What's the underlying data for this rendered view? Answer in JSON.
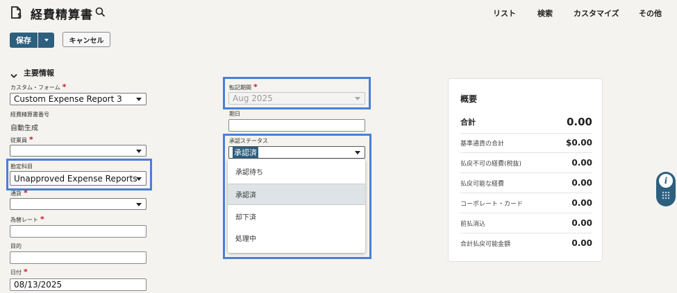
{
  "header": {
    "title": "経費精算書",
    "nav": [
      "リスト",
      "検索",
      "カスタマイズ",
      "その他"
    ]
  },
  "toolbar": {
    "save_label": "保存",
    "cancel_label": "キャンセル"
  },
  "section": {
    "title": "主要情報"
  },
  "fields": {
    "custom_form": {
      "label": "カスタム・フォーム",
      "value": "Custom Expense Report 3"
    },
    "report_number": {
      "label": "経費精算書番号",
      "value": "自動生成"
    },
    "employee": {
      "label": "従業員",
      "value": ""
    },
    "account": {
      "label": "勘定科目",
      "value": "Unapproved Expense Reports"
    },
    "currency": {
      "label": "通貨",
      "value": ""
    },
    "exchange_rate": {
      "label": "為替レート",
      "value": ""
    },
    "purpose": {
      "label": "目的",
      "value": ""
    },
    "date": {
      "label": "日付",
      "value": "08/13/2025"
    },
    "posting_period": {
      "label": "転記期間",
      "value": "Aug 2025"
    },
    "due_date": {
      "label": "期日",
      "value": ""
    },
    "approval_status": {
      "label": "承認ステータス",
      "value": "承認済",
      "options": [
        "承認待ち",
        "承認済",
        "却下済",
        "処理中"
      ]
    }
  },
  "summary": {
    "title": "概要",
    "rows": [
      {
        "label": "合計",
        "value": "0.00"
      },
      {
        "label": "基準通貨の合計",
        "value": "$0.00"
      },
      {
        "label": "払戻不可の経費(税抜)",
        "value": "0.00"
      },
      {
        "label": "払戻可能な経費",
        "value": "0.00"
      },
      {
        "label": "コーポレート・カード",
        "value": "0.00"
      },
      {
        "label": "前払消込",
        "value": "0.00"
      },
      {
        "label": "合計払戻可能金額",
        "value": "0.00"
      }
    ]
  },
  "colors": {
    "primary": "#2d5f7e",
    "highlight": "#4a7fd6",
    "required": "#c21a1a",
    "selected_option": "#dde3e6"
  }
}
